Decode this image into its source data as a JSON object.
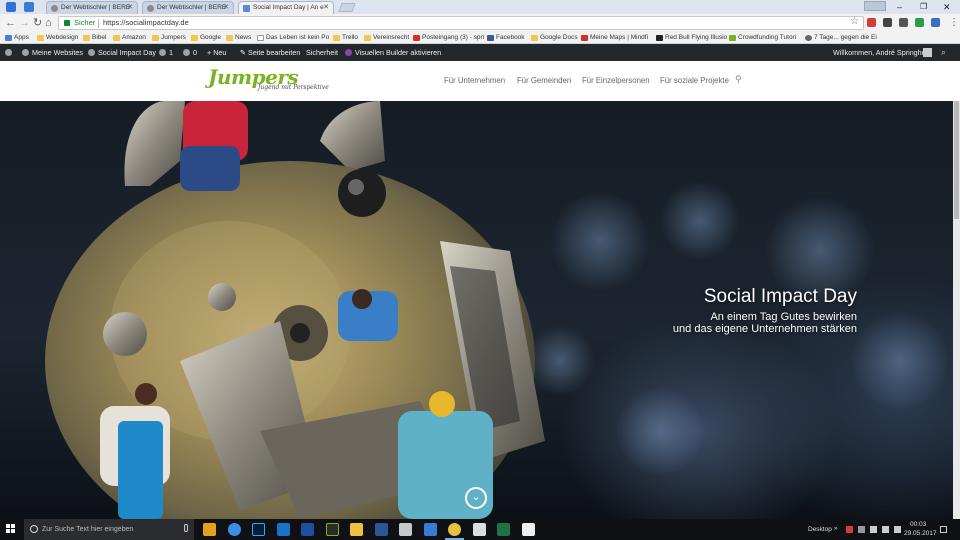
{
  "browser": {
    "tabs": [
      {
        "label": "Der Webtischler | BERE",
        "active": false
      },
      {
        "label": "Der Webtischler | BERE",
        "active": false
      },
      {
        "label": "Social Impact Day | An e",
        "active": true
      }
    ],
    "user_badge": "",
    "window_controls": {
      "minimize": "–",
      "maximize": "❐",
      "close": "✕"
    },
    "omnibox": {
      "secure_label": "Sicher",
      "url": "https://socialimpactday.de"
    },
    "icons": [
      "back-icon",
      "forward-icon",
      "reload-icon",
      "home-icon",
      "star-icon",
      "menu-icon"
    ]
  },
  "bookmarks": [
    {
      "label": "Apps"
    },
    {
      "label": "Webdesign"
    },
    {
      "label": "Bibel"
    },
    {
      "label": "Amazon"
    },
    {
      "label": "Jumpers"
    },
    {
      "label": "Google"
    },
    {
      "label": "News"
    },
    {
      "label": "Das Leben ist kein Po"
    },
    {
      "label": "Trello"
    },
    {
      "label": "Vereinsrecht"
    },
    {
      "label": "Posteingang (3) - spri"
    },
    {
      "label": "Facebook"
    },
    {
      "label": "Google Docs"
    },
    {
      "label": "Meine Maps | Mindfi"
    },
    {
      "label": "Red Bull Flying Illusio"
    },
    {
      "label": "Crowdfunding Tutori"
    },
    {
      "label": "7 Tage... gegen die Ei"
    }
  ],
  "adminbar": {
    "my_sites": "Meine Websites",
    "site_name": "Social Impact Day",
    "updates": "1",
    "comments": "0",
    "new": "Neu",
    "edit_page": "Seite bearbeiten",
    "security": "Sicherheit",
    "visual_builder": "Visuellen Builder aktivieren",
    "greeting": "Willkommen, André Springhut"
  },
  "site": {
    "logo": "Jumpers",
    "tagline": "Jugend mit Perspektive",
    "nav": [
      {
        "label": "Für Unternehmen"
      },
      {
        "label": "Für Gemeinden"
      },
      {
        "label": "Für Einzelpersonen"
      },
      {
        "label": "Für soziale Projekte"
      }
    ],
    "brand_color": "#7ab321"
  },
  "hero": {
    "title": "Social Impact Day",
    "subtitle_line1": "An einem Tag Gutes bewirken",
    "subtitle_line2": "und das eigene Unternehmen stärken"
  },
  "taskbar": {
    "search_placeholder": "Zur Suche Text hier eingeben",
    "desktop_label": "Desktop",
    "time": "00:03",
    "date": "29.05.2017"
  }
}
